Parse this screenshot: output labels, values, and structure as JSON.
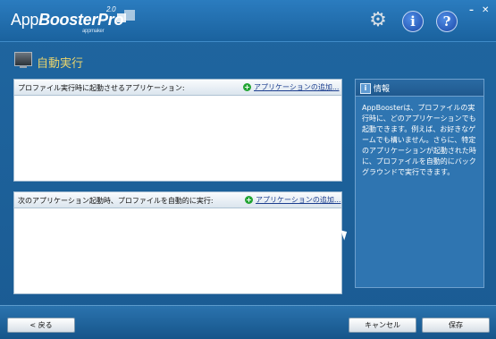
{
  "app": {
    "title_regular": "App",
    "title_bold": "BoosterPro",
    "version": "2.0",
    "subtitle": "appmaker"
  },
  "toolbar": {
    "settings_icon": "gear-icon",
    "info_icon": "info-icon",
    "help_icon": "help-icon",
    "info_label": "i",
    "help_label": "?",
    "minimize_label": "–",
    "close_label": "✕"
  },
  "section": {
    "title": "自動実行"
  },
  "panes": [
    {
      "caption": "プロファイル実行時に起動させるアプリケーション:",
      "add_label": "アプリケーションの追加..."
    },
    {
      "caption": "次のアプリケーション起動時、プロファイルを自動的に実行:",
      "add_label": "アプリケーションの追加..."
    }
  ],
  "info": {
    "title": "情報",
    "text": "AppBoosterは、プロファイルの実行時に、どのアプリケーションでも起動できます。例えば、お好きなゲームでも構いません。さらに、特定のアプリケーションが起動された時に、プロファイルを自動的にバックグラウンドで実行できます。"
  },
  "buttons": {
    "back": "< 戻る",
    "cancel": "キャンセル",
    "save": "保存"
  },
  "colors": {
    "window_blue": "#1b5d93",
    "section_title": "#e8d36d",
    "link": "#1d3f8f",
    "add_green": "#23a535"
  }
}
